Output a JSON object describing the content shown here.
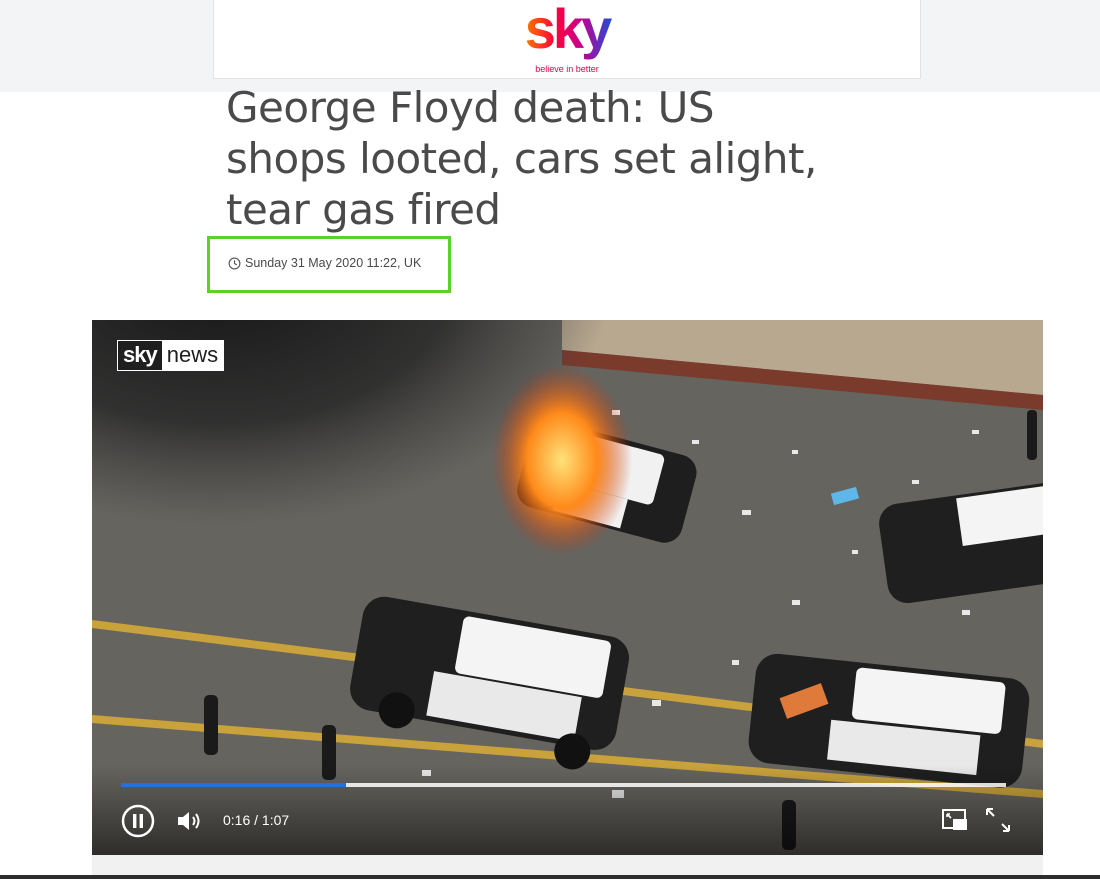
{
  "header": {
    "logo_text": "sky",
    "tagline": "believe in better"
  },
  "article": {
    "headline": "George Floyd death: US shops looted, cars set alight, tear gas fired",
    "timestamp": "Sunday 31 May 2020 11:22, UK",
    "highlight_color": "#5bd12b"
  },
  "video": {
    "badge_sky": "sky",
    "badge_news": "news",
    "current_time": "0:16",
    "duration": "1:07",
    "time_display": "0:16 / 1:07",
    "progress_fraction": 0.254,
    "progress_color": "#2a6fd3",
    "icons": {
      "pause": "pause-icon",
      "volume": "volume-icon",
      "pip": "picture-in-picture-icon",
      "fullscreen": "fullscreen-icon",
      "clock": "clock-icon"
    }
  }
}
